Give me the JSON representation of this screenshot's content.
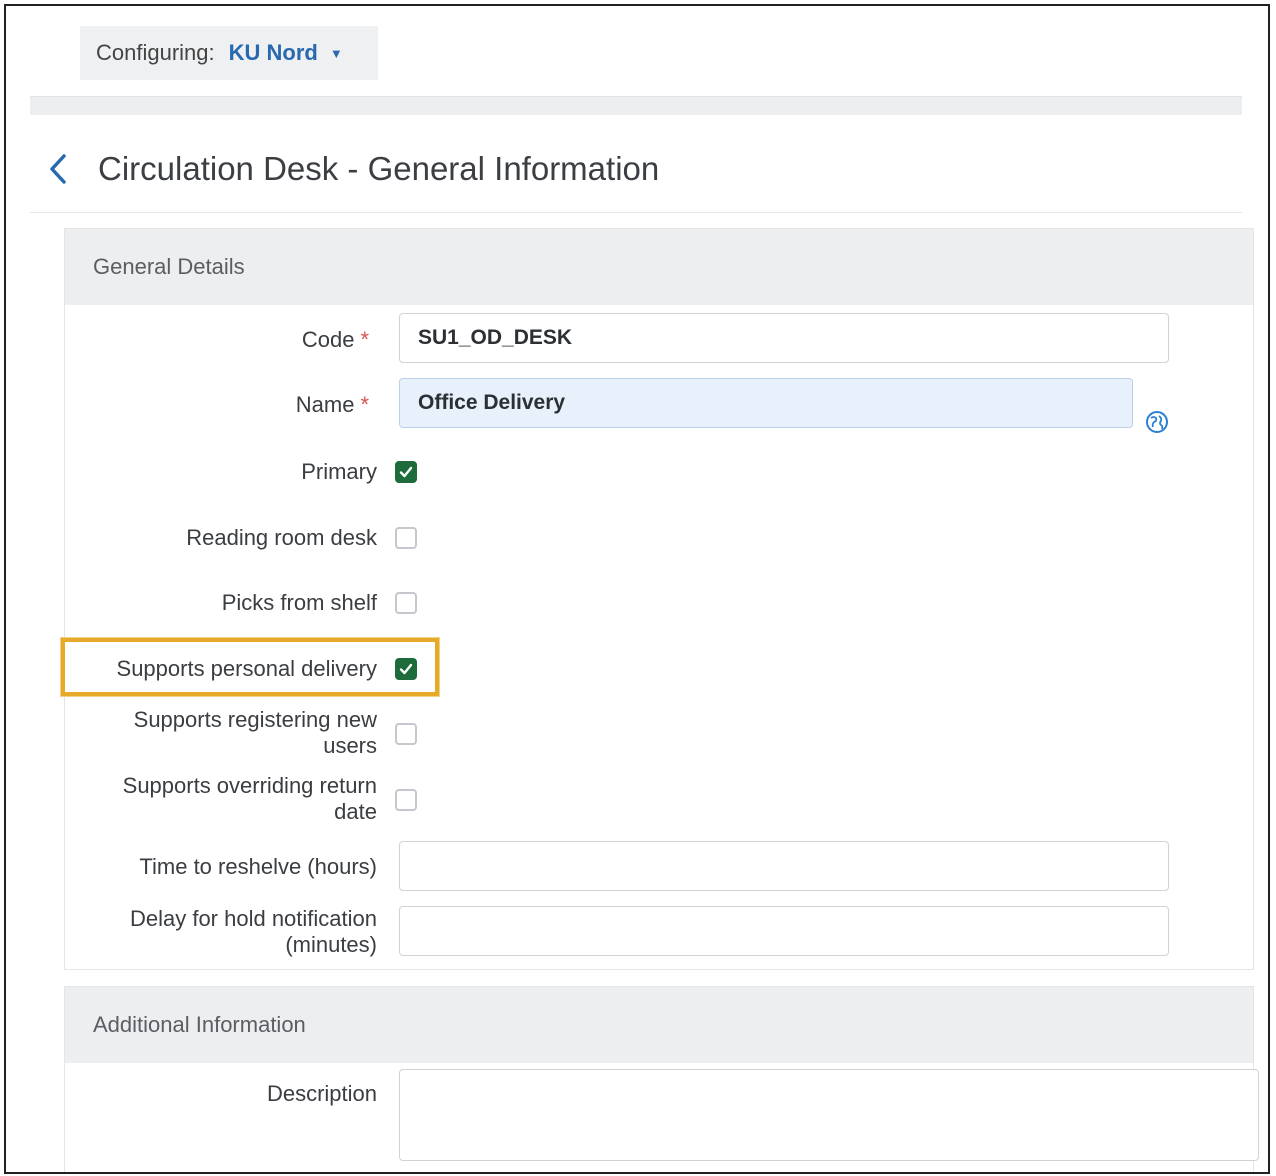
{
  "configuring": {
    "label": "Configuring:",
    "value": "KU Nord",
    "caret": "▼"
  },
  "page": {
    "title": "Circulation Desk - General Information"
  },
  "general_details": {
    "header": "General Details",
    "code": {
      "label": "Code",
      "required_mark": "*",
      "value": "SU1_OD_DESK"
    },
    "name": {
      "label": "Name",
      "required_mark": "*",
      "value": "Office Delivery"
    },
    "primary": {
      "label": "Primary",
      "checked": true
    },
    "reading_room_desk": {
      "label": "Reading room desk",
      "checked": false
    },
    "picks_from_shelf": {
      "label": "Picks from shelf",
      "checked": false
    },
    "supports_personal_delivery": {
      "label": "Supports personal delivery",
      "checked": true
    },
    "supports_registering_new_users": {
      "label_line1": "Supports registering new",
      "label_line2": "users",
      "checked": false
    },
    "supports_overriding_return_date": {
      "label_line1": "Supports overriding return",
      "label_line2": "date",
      "checked": false
    },
    "time_to_reshelve": {
      "label": "Time to reshelve (hours)",
      "value": ""
    },
    "delay_for_hold_notification": {
      "label_line1": "Delay for hold notification",
      "label_line2": "(minutes)",
      "value": ""
    }
  },
  "additional_information": {
    "header": "Additional Information",
    "description": {
      "label": "Description",
      "value": ""
    }
  },
  "colors": {
    "accent_blue": "#2869b0",
    "checkbox_green": "#1e6b3b",
    "highlight_orange": "#e7a928",
    "required_red": "#d9534f"
  }
}
